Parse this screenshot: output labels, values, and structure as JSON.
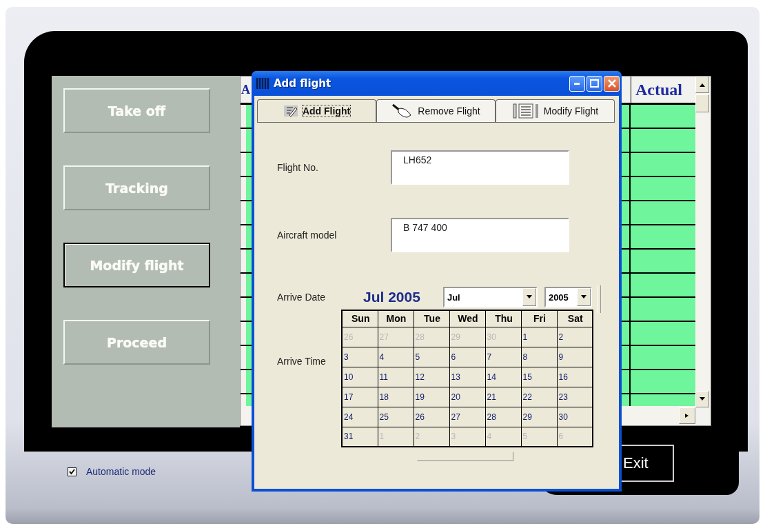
{
  "main_window": {
    "nav_buttons": [
      {
        "label": "Take off",
        "focused": false
      },
      {
        "label": "Tracking",
        "focused": false
      },
      {
        "label": "Modify flight",
        "focused": true
      },
      {
        "label": "Proceed",
        "focused": false
      }
    ],
    "table": {
      "columns": [
        "A",
        "Actual"
      ]
    },
    "automatic_mode": {
      "label": "Automatic mode",
      "checked": true
    },
    "exit_button": {
      "label": "Exit"
    }
  },
  "dialog": {
    "title": "Add flight",
    "tabs": [
      {
        "label": "Add Flight",
        "selected": true
      },
      {
        "label": "Remove Flight",
        "selected": false
      },
      {
        "label": "Modify Flight",
        "selected": false
      }
    ],
    "fields": [
      {
        "label": "Flight No.",
        "value": "LH652"
      },
      {
        "label": "Aircraft model",
        "value": "B 747 400"
      }
    ],
    "arrive_date": {
      "label": "Arrive Date",
      "calendar_title": "Jul 2005",
      "month": "Jul",
      "year": "2005",
      "weekdays": [
        "Sun",
        "Mon",
        "Tue",
        "Wed",
        "Thu",
        "Fri",
        "Sat"
      ],
      "weeks": [
        [
          {
            "day": "26",
            "dim": true
          },
          {
            "day": "27",
            "dim": true
          },
          {
            "day": "28",
            "dim": true
          },
          {
            "day": "29",
            "dim": true
          },
          {
            "day": "30",
            "dim": true
          },
          {
            "day": "1",
            "dim": false
          },
          {
            "day": "2",
            "dim": false
          }
        ],
        [
          {
            "day": "3",
            "dim": false
          },
          {
            "day": "4",
            "dim": false
          },
          {
            "day": "5",
            "dim": false
          },
          {
            "day": "6",
            "dim": false
          },
          {
            "day": "7",
            "dim": false
          },
          {
            "day": "8",
            "dim": false
          },
          {
            "day": "9",
            "dim": false
          }
        ],
        [
          {
            "day": "10",
            "dim": false
          },
          {
            "day": "11",
            "dim": false
          },
          {
            "day": "12",
            "dim": false
          },
          {
            "day": "13",
            "dim": false
          },
          {
            "day": "14",
            "dim": false
          },
          {
            "day": "15",
            "dim": false
          },
          {
            "day": "16",
            "dim": false
          }
        ],
        [
          {
            "day": "17",
            "dim": false
          },
          {
            "day": "18",
            "dim": false
          },
          {
            "day": "19",
            "dim": false
          },
          {
            "day": "20",
            "dim": false
          },
          {
            "day": "21",
            "dim": false
          },
          {
            "day": "22",
            "dim": false
          },
          {
            "day": "23",
            "dim": false
          }
        ],
        [
          {
            "day": "24",
            "dim": false
          },
          {
            "day": "25",
            "dim": false
          },
          {
            "day": "26",
            "dim": false
          },
          {
            "day": "27",
            "dim": false
          },
          {
            "day": "28",
            "dim": false
          },
          {
            "day": "29",
            "dim": false
          },
          {
            "day": "30",
            "dim": false
          }
        ],
        [
          {
            "day": "31",
            "dim": false
          },
          {
            "day": "1",
            "dim": true
          },
          {
            "day": "2",
            "dim": true
          },
          {
            "day": "3",
            "dim": true
          },
          {
            "day": "4",
            "dim": true
          },
          {
            "day": "5",
            "dim": true
          },
          {
            "day": "6",
            "dim": true
          }
        ]
      ]
    },
    "arrive_time": {
      "label": "Arrive Time"
    }
  }
}
